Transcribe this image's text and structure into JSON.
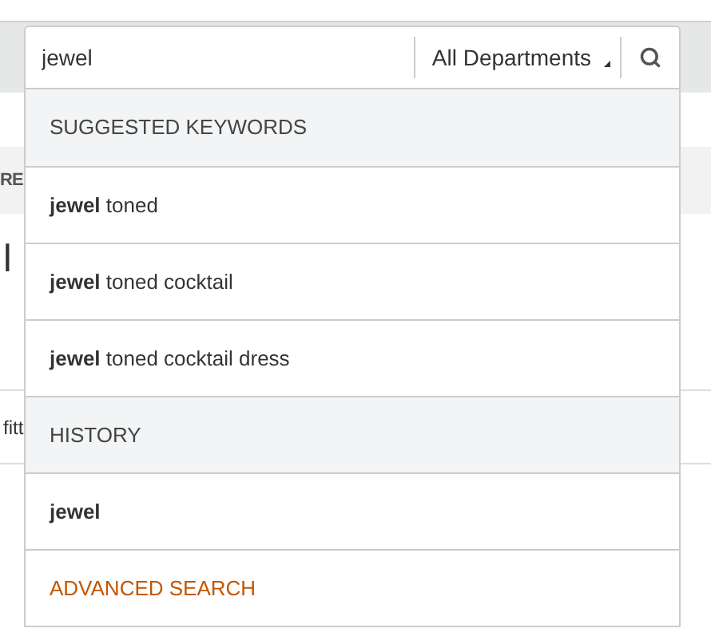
{
  "search": {
    "value": "jewel",
    "department": "All Departments"
  },
  "background": {
    "band_text": "RE",
    "heading": "l",
    "cell_text": "fitt"
  },
  "dropdown": [
    {
      "kind": "header",
      "text": "SUGGESTED KEYWORDS"
    },
    {
      "kind": "suggestion",
      "text": "**jewel** toned"
    },
    {
      "kind": "suggestion",
      "text": "**jewel** toned cocktail"
    },
    {
      "kind": "suggestion",
      "text": "**jewel** toned cocktail dress"
    },
    {
      "kind": "header",
      "text": "HISTORY"
    },
    {
      "kind": "history",
      "text": "jewel"
    },
    {
      "kind": "link",
      "text": "ADVANCED SEARCH"
    }
  ]
}
